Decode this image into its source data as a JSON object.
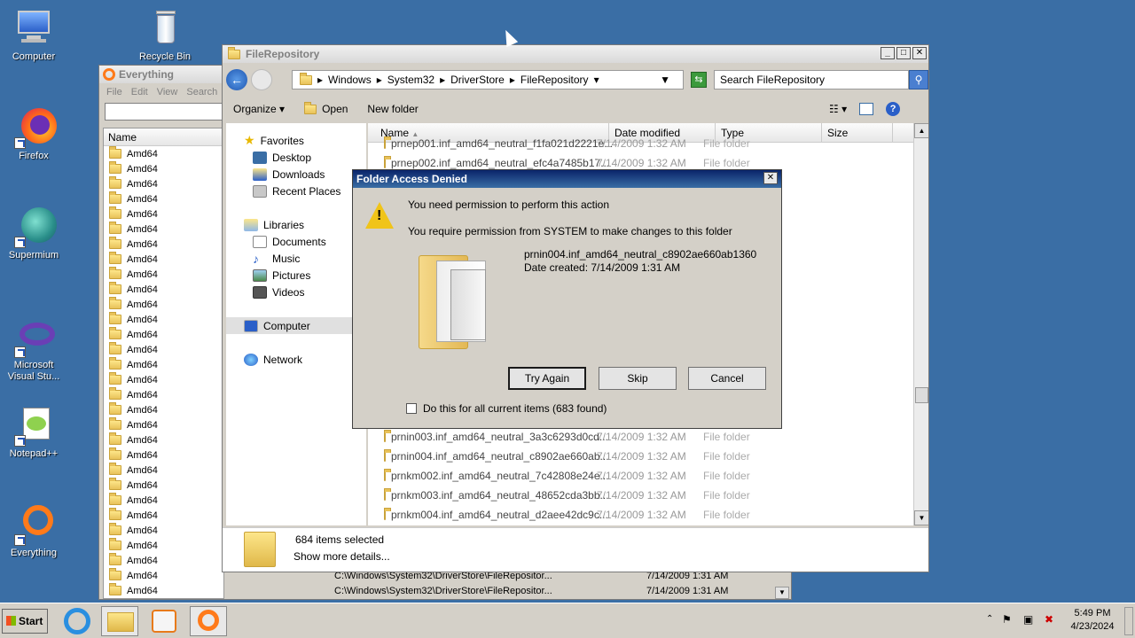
{
  "desktop": {
    "icons": [
      {
        "label": "Computer",
        "icon": "computer-icon"
      },
      {
        "label": "Recycle Bin",
        "icon": "recycle-bin-icon"
      },
      {
        "label": "Firefox",
        "icon": "firefox-icon"
      },
      {
        "label": "Supermium",
        "icon": "supermium-icon"
      },
      {
        "label": "Microsoft Visual Stu...",
        "icon": "visual-studio-icon"
      },
      {
        "label": "Notepad++",
        "icon": "notepadpp-icon"
      },
      {
        "label": "Everything",
        "icon": "everything-icon"
      }
    ]
  },
  "everything": {
    "title": "Everything",
    "menu": [
      "File",
      "Edit",
      "View",
      "Search"
    ],
    "column_name": "Name",
    "row_label": "Amd64",
    "paths": [
      {
        "path": "C:\\Windows\\System32\\DriverStore\\FileRepositor...",
        "date": "7/14/2009 1:31 AM"
      },
      {
        "path": "C:\\Windows\\System32\\DriverStore\\FileRepositor...",
        "date": "7/14/2009 1:31 AM"
      }
    ]
  },
  "explorer": {
    "title": "FileRepository",
    "breadcrumb": [
      "Windows",
      "System32",
      "DriverStore",
      "FileRepository"
    ],
    "search_placeholder": "Search FileRepository",
    "toolbar": {
      "organize": "Organize",
      "open": "Open",
      "new_folder": "New folder"
    },
    "nav": {
      "favorites": "Favorites",
      "desktop": "Desktop",
      "downloads": "Downloads",
      "recent": "Recent Places",
      "libraries": "Libraries",
      "documents": "Documents",
      "music": "Music",
      "pictures": "Pictures",
      "videos": "Videos",
      "computer": "Computer",
      "network": "Network"
    },
    "columns": {
      "name": "Name",
      "date": "Date modified",
      "type": "Type",
      "size": "Size"
    },
    "rows_top": [
      {
        "name": "prnep001.inf_amd64_neutral_f1fa021d2221e...",
        "date": "7/14/2009 1:32 AM",
        "type": "File folder"
      },
      {
        "name": "prnep002.inf_amd64_neutral_efc4a7485b17...",
        "date": "7/14/2009 1:32 AM",
        "type": "File folder"
      }
    ],
    "rows_bottom": [
      {
        "name": "prnin003.inf_amd64_neutral_3a3c6293d0cd...",
        "date": "7/14/2009 1:32 AM",
        "type": "File folder"
      },
      {
        "name": "prnin004.inf_amd64_neutral_c8902ae660ab...",
        "date": "7/14/2009 1:32 AM",
        "type": "File folder"
      },
      {
        "name": "prnkm002.inf_amd64_neutral_7c42808e24e...",
        "date": "7/14/2009 1:32 AM",
        "type": "File folder"
      },
      {
        "name": "prnkm003.inf_amd64_neutral_48652cda3bb...",
        "date": "7/14/2009 1:32 AM",
        "type": "File folder"
      },
      {
        "name": "prnkm004.inf_amd64_neutral_d2aee42dc9c...",
        "date": "7/14/2009 1:32 AM",
        "type": "File folder"
      }
    ],
    "details": {
      "count": "684 items selected",
      "more": "Show more details..."
    }
  },
  "dialog": {
    "title": "Folder Access Denied",
    "heading": "You need permission to perform this action",
    "message": "You require permission from SYSTEM to make changes to this folder",
    "item_name": "prnin004.inf_amd64_neutral_c8902ae660ab1360",
    "item_date": "Date created: 7/14/2009 1:31 AM",
    "buttons": {
      "try_again": "Try Again",
      "skip": "Skip",
      "cancel": "Cancel"
    },
    "checkbox_label": "Do this for all current items (683 found)"
  },
  "taskbar": {
    "start": "Start",
    "time": "5:49 PM",
    "date": "4/23/2024"
  }
}
